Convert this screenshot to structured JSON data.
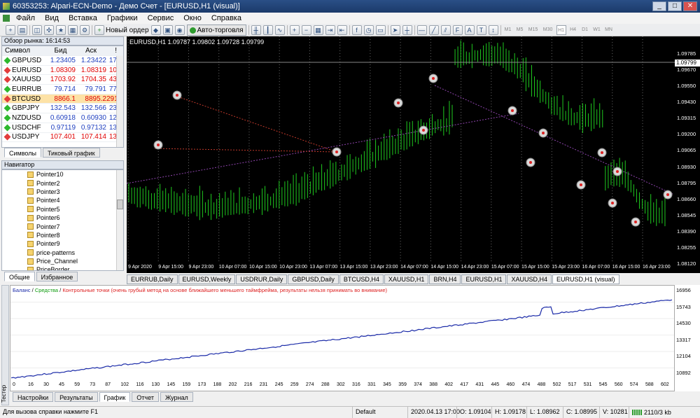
{
  "window": {
    "title": "60353253: Alpari-ECN-Demo - Демо Счет - [EURUSD,H1 (visual)]"
  },
  "menu": [
    "Файл",
    "Вид",
    "Вставка",
    "Графики",
    "Сервис",
    "Окно",
    "Справка"
  ],
  "toolbar": {
    "new_order": "Новый ордер",
    "autotrading": "Авто-торговля",
    "timeframes": [
      "M1",
      "M5",
      "M15",
      "M30",
      "H1",
      "H4",
      "D1",
      "W1",
      "MN"
    ]
  },
  "market_watch": {
    "header": "Обзор рынка: 16:14:53",
    "cols": {
      "symbol": "Символ",
      "bid": "Бид",
      "ask": "Аск",
      "spread": "!"
    },
    "rows": [
      {
        "sym": "GBPUSD",
        "bid": "1.23405",
        "ask": "1.23422",
        "spr": "17",
        "color": "#2db82d"
      },
      {
        "sym": "EURUSD",
        "bid": "1.08309",
        "ask": "1.08319",
        "spr": "10",
        "color": "#e23b3b"
      },
      {
        "sym": "XAUUSD",
        "bid": "1703.92",
        "ask": "1704.35",
        "spr": "43",
        "color": "#e23b3b"
      },
      {
        "sym": "EURRUB",
        "bid": "79.714",
        "ask": "79.791",
        "spr": "77",
        "color": "#2db82d"
      },
      {
        "sym": "BTCUSD",
        "bid": "8866.1",
        "ask": "8895.2",
        "spr": "291",
        "color": "#e23b3b"
      },
      {
        "sym": "GBPJPY",
        "bid": "132.543",
        "ask": "132.566",
        "spr": "23",
        "color": "#2db82d"
      },
      {
        "sym": "NZDUSD",
        "bid": "0.60918",
        "ask": "0.60930",
        "spr": "12",
        "color": "#2db82d"
      },
      {
        "sym": "USDCHF",
        "bid": "0.97119",
        "ask": "0.97132",
        "spr": "13",
        "color": "#2db82d"
      },
      {
        "sym": "USDJPY",
        "bid": "107.401",
        "ask": "107.414",
        "spr": "13",
        "color": "#e23b3b"
      }
    ],
    "tabs": [
      "Символы",
      "Тиковый график"
    ]
  },
  "navigator": {
    "header": "Навигатор",
    "items": [
      "Pointer10",
      "Pointer2",
      "Pointer3",
      "Pointer4",
      "Pointer5",
      "Pointer6",
      "Pointer7",
      "Pointer8",
      "Pointer9",
      "price-patterns",
      "Price_Channel",
      "PriceBorder"
    ],
    "tabs": [
      "Общие",
      "Избранное"
    ]
  },
  "chart": {
    "info": "EURUSD,H1  1.09787 1.09802 1.09728 1.09799",
    "current_price": "1.09799",
    "price_labels": [
      "1.09785",
      "1.09670",
      "1.09550",
      "1.09430",
      "1.09315",
      "1.09200",
      "1.09065",
      "1.08930",
      "1.08795",
      "1.08660",
      "1.08545",
      "1.08390",
      "1.08255",
      "1.08120"
    ],
    "time_labels": [
      "9 Apr 2020",
      "9 Apr 15:00",
      "9 Apr 23:00",
      "10 Apr 07:00",
      "10 Apr 15:00",
      "10 Apr 23:00",
      "13 Apr 07:00",
      "13 Apr 15:00",
      "13 Apr 23:00",
      "14 Apr 07:00",
      "14 Apr 15:00",
      "14 Apr 23:00",
      "15 Apr 07:00",
      "15 Apr 15:00",
      "15 Apr 23:00",
      "16 Apr 07:00",
      "16 Apr 15:00",
      "16 Apr 23:00"
    ],
    "tabs": [
      "EURRUB,Daily",
      "EURUSD,Weekly",
      "USDRUR,Daily",
      "GBPUSD,Daily",
      "BTCUSD,H4",
      "XAUUSD,H1",
      "BRN,H4",
      "EURUSD,H1",
      "XAUUSD,H4",
      "EURUSD,H1 (visual)"
    ],
    "active_tab": 9
  },
  "tester": {
    "legend_balance": "Баланс",
    "legend_equity": "Средства",
    "legend_note": "Контрольные точки (очень грубый метод на основе ближайшего меньшего таймфрейма, результаты нельзя принимать во внимание)",
    "y_labels": [
      "16956",
      "15743",
      "14530",
      "13317",
      "12104",
      "10892"
    ],
    "x_labels": [
      "0",
      "16",
      "30",
      "45",
      "59",
      "73",
      "87",
      "102",
      "116",
      "130",
      "145",
      "159",
      "173",
      "188",
      "202",
      "216",
      "231",
      "245",
      "259",
      "274",
      "288",
      "302",
      "316",
      "331",
      "345",
      "359",
      "374",
      "388",
      "402",
      "417",
      "431",
      "445",
      "460",
      "474",
      "488",
      "502",
      "517",
      "531",
      "545",
      "560",
      "574",
      "588",
      "602"
    ],
    "tabs": [
      "Настройки",
      "Результаты",
      "График",
      "Отчет",
      "Журнал"
    ],
    "active_tab": 2,
    "side_label": "Тестер"
  },
  "status": {
    "help": "Для вызова справки нажмите F1",
    "profile": "Default",
    "datetime": "2020.04.13 17:00",
    "open": "O: 1.09104",
    "high": "H: 1.09178",
    "low": "L: 1.08962",
    "close": "C: 1.08995",
    "volume": "V: 10281",
    "traffic": "2110/3 kb"
  }
}
